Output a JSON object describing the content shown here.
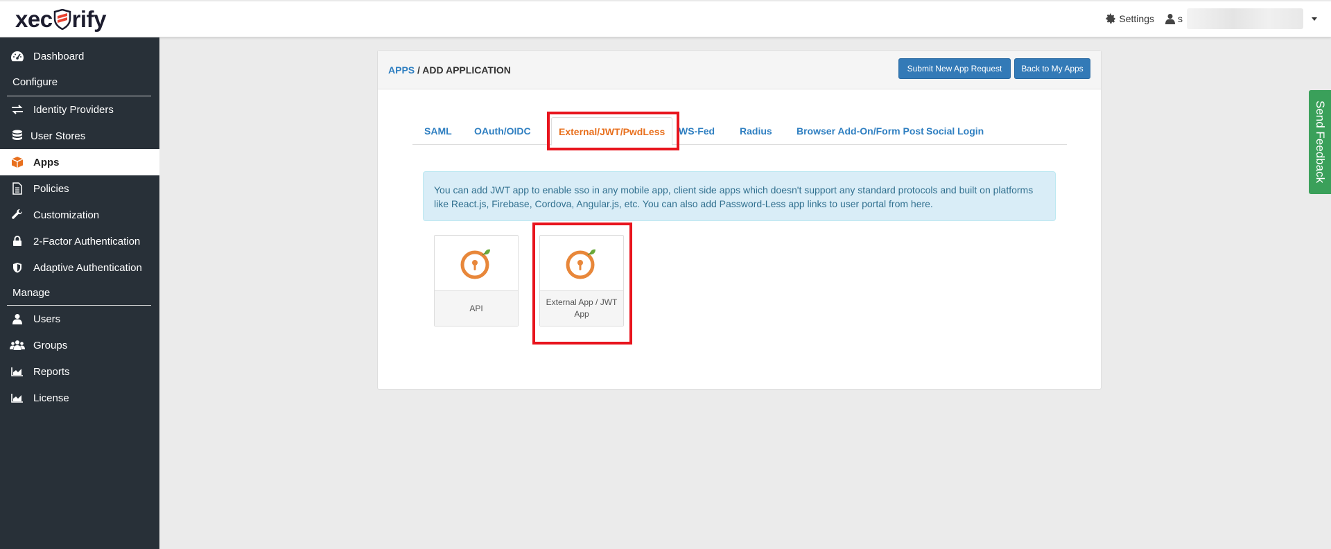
{
  "brand": {
    "logo_text_left": "xec",
    "logo_text_right": "rify"
  },
  "header": {
    "settings_label": "Settings",
    "user_initial": "s"
  },
  "sidebar": {
    "items": [
      {
        "label": "Dashboard",
        "icon": "dashboard-icon"
      },
      {
        "label": "Identity Providers",
        "icon": "exchange-icon"
      },
      {
        "label": "User Stores",
        "icon": "database-icon"
      },
      {
        "label": "Apps",
        "icon": "cube-icon",
        "active": true
      },
      {
        "label": "Policies",
        "icon": "document-icon"
      },
      {
        "label": "Customization",
        "icon": "wrench-icon"
      },
      {
        "label": "2-Factor Authentication",
        "icon": "lock-icon"
      },
      {
        "label": "Adaptive Authentication",
        "icon": "shield-icon"
      },
      {
        "label": "Users",
        "icon": "user-icon"
      },
      {
        "label": "Groups",
        "icon": "users-icon"
      },
      {
        "label": "Reports",
        "icon": "chart-icon"
      },
      {
        "label": "License",
        "icon": "chart-icon"
      }
    ],
    "sections": {
      "configure": "Configure",
      "manage": "Manage"
    }
  },
  "feedback_label": "Send Feedback",
  "panel": {
    "breadcrumb_link": "APPS",
    "breadcrumb_sep": " / ",
    "breadcrumb_current": "ADD APPLICATION",
    "submit_button": "Submit New App Request",
    "back_button": "Back to My Apps"
  },
  "tabs": [
    {
      "label": "SAML"
    },
    {
      "label": "OAuth/OIDC"
    },
    {
      "label": "External/JWT/PwdLess",
      "active": true
    },
    {
      "label": "WS-Fed"
    },
    {
      "label": "Radius"
    },
    {
      "label": "Browser Add-On/Form Post"
    },
    {
      "label": "Social Login"
    }
  ],
  "info_text": "You can add JWT app to enable sso in any mobile app, client side apps which doesn't support any standard protocols and built on platforms like React.js, Firebase, Cordova, Angular.js, etc. You can also add Password-Less app links to user portal from here.",
  "apps": [
    {
      "label": "API"
    },
    {
      "label": "External App / JWT App"
    }
  ],
  "colors": {
    "sidebar_bg": "#283038",
    "accent_orange": "#e8701e",
    "link_blue": "#2f7fc1",
    "button_blue": "#337ab7",
    "highlight_red": "#e8141d",
    "feedback_green": "#3aa05a"
  }
}
